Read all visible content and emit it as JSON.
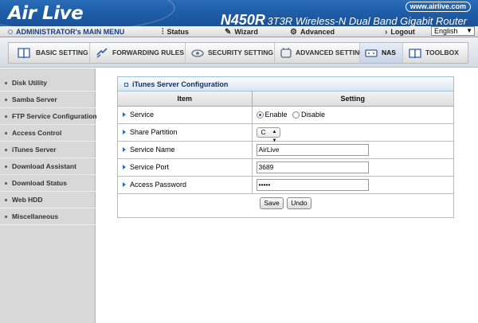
{
  "header": {
    "logo": "Air Live",
    "model_main": "N450R",
    "model_sub": "3T3R Wireless-N Dual Band Gigabit Router",
    "site_link": "www.airlive.com"
  },
  "main_menu": {
    "admin_label": "ADMINISTRATOR's MAIN MENU",
    "status_label": "Status",
    "wizard_label": "Wizard",
    "advanced_label": "Advanced",
    "logout_label": "Logout",
    "language": "English"
  },
  "tabs": [
    {
      "label": "BASIC SETTING",
      "icon": "book-icon"
    },
    {
      "label": "FORWARDING RULES",
      "icon": "arrows-icon"
    },
    {
      "label": "SECURITY SETTING",
      "icon": "security-icon"
    },
    {
      "label": "ADVANCED SETTING",
      "icon": "advanced-icon"
    },
    {
      "label": "NAS",
      "icon": "nas-icon",
      "active": true
    },
    {
      "label": "TOOLBOX",
      "icon": "toolbox-icon"
    }
  ],
  "sidebar": {
    "items": [
      {
        "label": "Disk Utility"
      },
      {
        "label": "Samba Server"
      },
      {
        "label": "FTP Service Configuration"
      },
      {
        "label": "Access Control"
      },
      {
        "label": "iTunes Server"
      },
      {
        "label": "Download Assistant"
      },
      {
        "label": "Download Status"
      },
      {
        "label": "Web HDD"
      },
      {
        "label": "Miscellaneous"
      }
    ]
  },
  "panel": {
    "title": "iTunes Server Configuration",
    "col_item": "Item",
    "col_setting": "Setting",
    "rows": {
      "service": "Service",
      "share_partition": "Share Partition",
      "service_name": "Service Name",
      "service_port": "Service Port",
      "access_password": "Access Password"
    },
    "service_enable": "Enable",
    "service_disable": "Disable",
    "service_selected": "Enable",
    "share_partition_value": "C",
    "service_name_value": "AirLive",
    "service_port_value": "3689",
    "access_password_value": "•••••",
    "save_label": "Save",
    "undo_label": "Undo"
  },
  "colors": {
    "banner": "#1f5ea8",
    "sidebar_bg": "#d8d8d8",
    "panel_border": "#9fc0d4",
    "row_arrow": "#2a6fc4"
  }
}
